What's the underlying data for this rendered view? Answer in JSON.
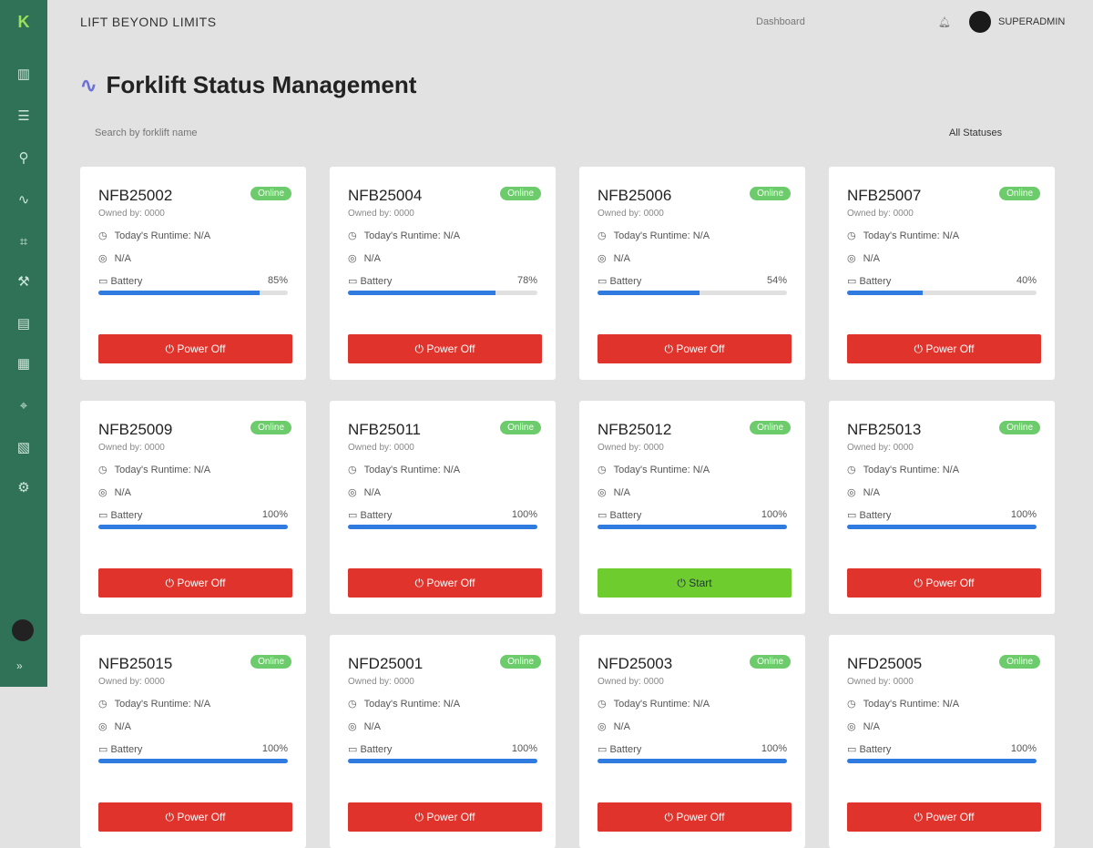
{
  "header": {
    "brand": "LIFT BEYOND LIMITS",
    "nav_text": "Dashboard",
    "user": "SUPERADMIN"
  },
  "page": {
    "title": "Forklift Status Management",
    "search_placeholder": "Search by forklift name",
    "filter": "All Statuses"
  },
  "labels": {
    "runtime": "Today's Runtime: N/A",
    "location": "N/A",
    "battery": "Battery"
  },
  "cards": [
    {
      "id": "NFB25002",
      "owner": "Owned by: 0000",
      "status": "Online",
      "battery": 85,
      "battery_label": "85%",
      "action": "Power Off"
    },
    {
      "id": "NFB25004",
      "owner": "Owned by: 0000",
      "status": "Online",
      "battery": 78,
      "battery_label": "78%",
      "action": "Power Off"
    },
    {
      "id": "NFB25006",
      "owner": "Owned by: 0000",
      "status": "Online",
      "battery": 54,
      "battery_label": "54%",
      "action": "Power Off"
    },
    {
      "id": "NFB25007",
      "owner": "Owned by: 0000",
      "status": "Online",
      "battery": 40,
      "battery_label": "40%",
      "action": "Power Off"
    },
    {
      "id": "NFB25009",
      "owner": "Owned by: 0000",
      "status": "Online",
      "battery": 100,
      "battery_label": "100%",
      "action": "Power Off"
    },
    {
      "id": "NFB25011",
      "owner": "Owned by: 0000",
      "status": "Online",
      "battery": 100,
      "battery_label": "100%",
      "action": "Power Off"
    },
    {
      "id": "NFB25012",
      "owner": "Owned by: 0000",
      "status": "Online",
      "battery": 100,
      "battery_label": "100%",
      "action": "Start"
    },
    {
      "id": "NFB25013",
      "owner": "Owned by: 0000",
      "status": "Online",
      "battery": 100,
      "battery_label": "100%",
      "action": "Power Off"
    },
    {
      "id": "NFB25015",
      "owner": "Owned by: 0000",
      "status": "Online",
      "battery": 100,
      "battery_label": "100%",
      "action": "Power Off"
    },
    {
      "id": "NFD25001",
      "owner": "Owned by: 0000",
      "status": "Online",
      "battery": 100,
      "battery_label": "100%",
      "action": "Power Off"
    },
    {
      "id": "NFD25003",
      "owner": "Owned by: 0000",
      "status": "Online",
      "battery": 100,
      "battery_label": "100%",
      "action": "Power Off"
    },
    {
      "id": "NFD25005",
      "owner": "Owned by: 0000",
      "status": "Online",
      "battery": 100,
      "battery_label": "100%",
      "action": "Power Off"
    }
  ]
}
